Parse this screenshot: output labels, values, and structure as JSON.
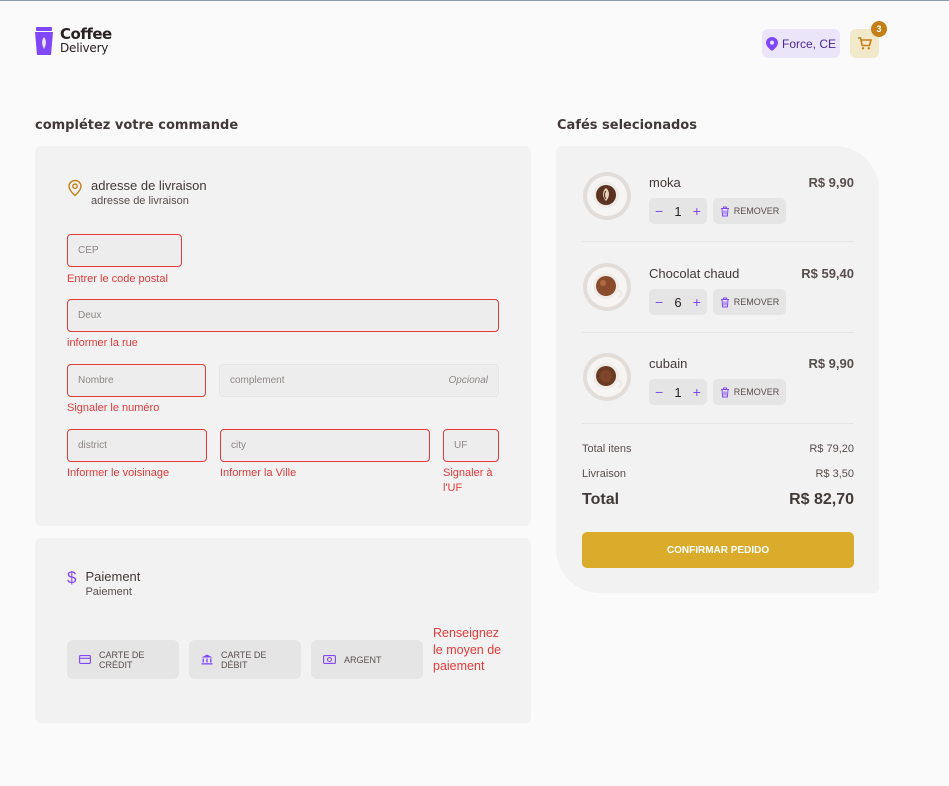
{
  "header": {
    "logo_line1": "Coffee",
    "logo_line2": "Delivery",
    "location": "Force, CE",
    "cart_count": "3"
  },
  "checkout": {
    "title": "complétez votre commande",
    "address": {
      "title": "adresse de livraison",
      "subtitle": "adresse de livraison",
      "cep_placeholder": "CEP",
      "cep_error": "Entrer le code postal",
      "street_placeholder": "Deux",
      "street_error": "informer la rue",
      "number_placeholder": "Nombre",
      "number_error": "Signaler le numéro",
      "complement_placeholder": "complement",
      "complement_optional": "Opcional",
      "district_placeholder": "district",
      "district_error": "Informer le voisinage",
      "city_placeholder": "city",
      "city_error": "Informer la Ville",
      "uf_placeholder": "UF",
      "uf_error": "Signaler à l'UF"
    },
    "payment": {
      "title": "Paiement",
      "subtitle": "Paiement",
      "options": [
        "CARTE DE CRÉDIT",
        "CARTE DE DÉBIT",
        "ARGENT"
      ],
      "error": "Renseignez le moyen de paiement"
    }
  },
  "cart": {
    "title": "Cafés selecionados",
    "items": [
      {
        "name": "moka",
        "price": "R$ 9,90",
        "qty": "1",
        "remove": "REMOVER"
      },
      {
        "name": "Chocolat chaud",
        "price": "R$ 59,40",
        "qty": "6",
        "remove": "REMOVER"
      },
      {
        "name": "cubain",
        "price": "R$ 9,90",
        "qty": "1",
        "remove": "REMOVER"
      }
    ],
    "summary": {
      "items_label": "Total itens",
      "items_value": "R$ 79,20",
      "delivery_label": "Livraison",
      "delivery_value": "R$ 3,50",
      "total_label": "Total",
      "total_value": "R$ 82,70"
    },
    "confirm_label": "CONFIRMAR PEDIDO"
  },
  "colors": {
    "purple": "#8047f8",
    "purple_light": "#ebe5f9",
    "yellow": "#dbac2c",
    "yellow_dark": "#c47f17",
    "error": "#e23b3b"
  }
}
